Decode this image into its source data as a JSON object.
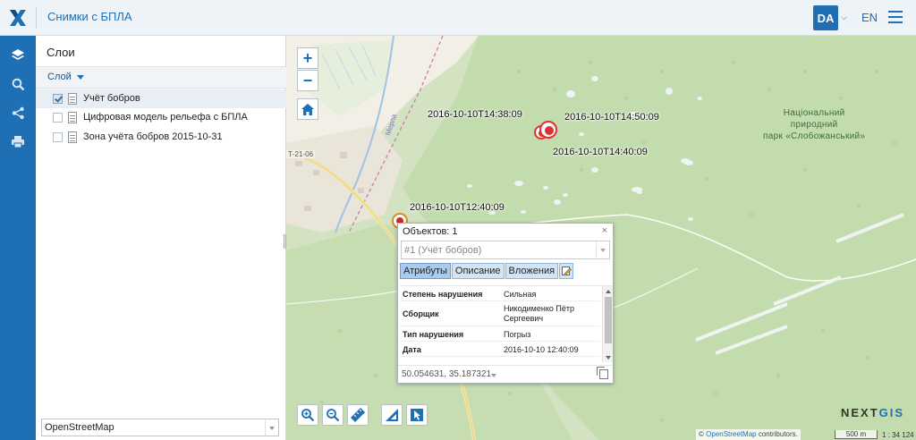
{
  "header": {
    "app_title": "Снимки с БПЛА",
    "lang_active": "DA",
    "lang_other": "EN",
    "logo_icon": "nextgis-x-logo",
    "menu_icon": "hamburger-menu-icon",
    "accent_color": "#1f6fb4"
  },
  "rail": {
    "items": [
      {
        "icon": "layers-icon"
      },
      {
        "icon": "search-icon"
      },
      {
        "icon": "share-icon"
      },
      {
        "icon": "print-icon"
      }
    ]
  },
  "layers_panel": {
    "title": "Слои",
    "toolbar_label": "Слой",
    "layers": [
      {
        "label": "Учёт бобров",
        "checked": true
      },
      {
        "label": "Цифровая модель рельефа с БПЛА",
        "checked": false
      },
      {
        "label": "Зона учёта бобров 2015-10-31",
        "checked": false
      }
    ],
    "basemap": "OpenStreetMap"
  },
  "map": {
    "zoom_in": "+",
    "zoom_out": "−",
    "marker_labels": [
      "2016-10-10T14:38:09",
      "2016-10-10T14:50:09",
      "2016-10-10T14:40:09",
      "2016-10-10T12:40:09"
    ],
    "park_label": [
      "Національний",
      "природний",
      "парк «Слобожанський»"
    ],
    "road_label": "Т-21-06",
    "canal_label": "Мерла",
    "brand_next": "NEXT",
    "brand_gis": "GIS",
    "attribution_prefix": "©",
    "attribution_link": "OpenStreetMap",
    "attribution_suffix": "contributors.",
    "scale_bar": "500 m",
    "scale_ratio": "1 : 34 124"
  },
  "popup": {
    "title": "Объектов: 1",
    "close": "×",
    "feature_select": "#1 (Учёт бобров)",
    "tabs": [
      "Атрибуты",
      "Описание",
      "Вложения"
    ],
    "attributes": [
      {
        "key": "Степень нарушения",
        "value": "Сильная"
      },
      {
        "key": "Сборщик",
        "value": "Никодименко Пётр Сергеевич"
      },
      {
        "key": "Тип нарушения",
        "value": "Погрыз"
      },
      {
        "key": "Дата",
        "value": "2016-10-10 12:40:09"
      }
    ],
    "coordinates": "50.054631, 35.187321"
  }
}
